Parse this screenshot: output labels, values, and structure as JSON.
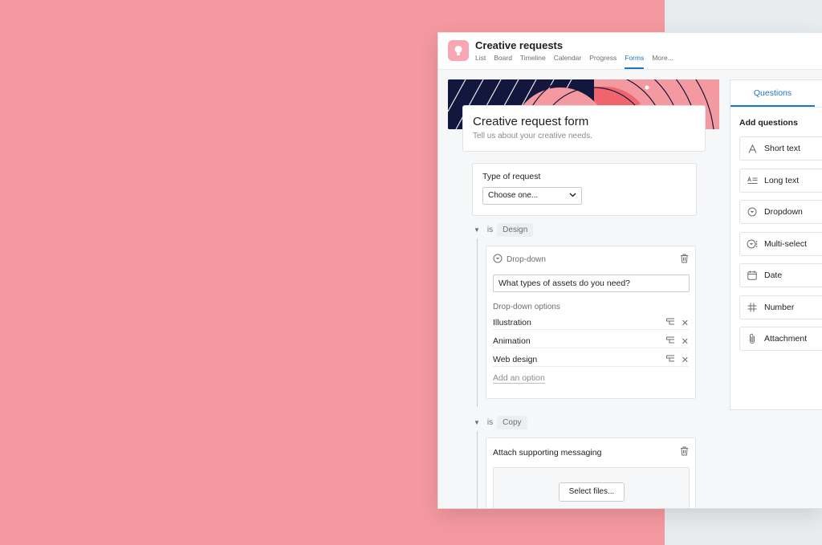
{
  "project": {
    "title": "Creative requests"
  },
  "tabs": [
    "List",
    "Board",
    "Timeline",
    "Calendar",
    "Progress",
    "Forms",
    "More..."
  ],
  "active_tab": "Forms",
  "form": {
    "title": "Creative request form",
    "subtitle": "Tell us about your creative needs."
  },
  "type_question": {
    "label": "Type of request",
    "select_value": "Choose one..."
  },
  "branch_design": {
    "is_label": "is",
    "value": "Design",
    "card": {
      "type_label": "Drop-down",
      "question": "What types of assets do you need?",
      "options_label": "Drop-down options",
      "options": [
        "Illustration",
        "Animation",
        "Web design"
      ],
      "add_option": "Add an option"
    }
  },
  "branch_copy": {
    "is_label": "is",
    "value": "Copy",
    "card": {
      "question": "Attach supporting messaging",
      "button": "Select files..."
    }
  },
  "sidebar": {
    "tab": "Questions",
    "title": "Add questions",
    "items": [
      {
        "label": "Short text",
        "icon": "letter-a-icon"
      },
      {
        "label": "Long text",
        "icon": "long-text-icon"
      },
      {
        "label": "Dropdown",
        "icon": "dropdown-icon"
      },
      {
        "label": "Multi-select",
        "icon": "multi-select-icon"
      },
      {
        "label": "Date",
        "icon": "calendar-icon"
      },
      {
        "label": "Number",
        "icon": "hash-icon"
      },
      {
        "label": "Attachment",
        "icon": "paperclip-icon"
      }
    ]
  },
  "colors": {
    "background_pink": "#f4999f",
    "accent_blue": "#1f76c2",
    "banner_navy": "#14173d",
    "banner_coral": "#f0646e"
  }
}
